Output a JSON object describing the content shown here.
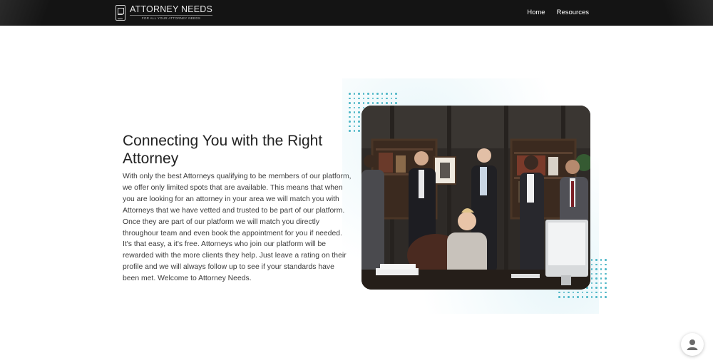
{
  "header": {
    "logo_title": "ATTORNEY NEEDS",
    "logo_tagline": "FOR ALL YOUR ATTORNEY NEEDS",
    "nav": [
      {
        "label": "Home"
      },
      {
        "label": "Resources"
      }
    ]
  },
  "main": {
    "heading": "Connecting You with the Right Attorney",
    "body": "With only the best Attorneys qualifying to be members of our platform, we offer only limited spots that are available. This means that when you are looking for an attorney in your area we will match you with Attorneys that we have vetted and trusted to be part of our platform. Once they are part of our platform we will match you directly throughour team and even book the appointment for you if needed. It's that easy, a it's free. Attorneys who join our platform will be rewarded with the more clients they help. Just leave a rating on their profile and we will always follow up to see if your standards have been met. Welcome to Attorney Needs."
  },
  "colors": {
    "header_bg": "#141414",
    "accent_dots": "#4fb7c7"
  },
  "icons": {
    "chat": "user-avatar-icon"
  }
}
